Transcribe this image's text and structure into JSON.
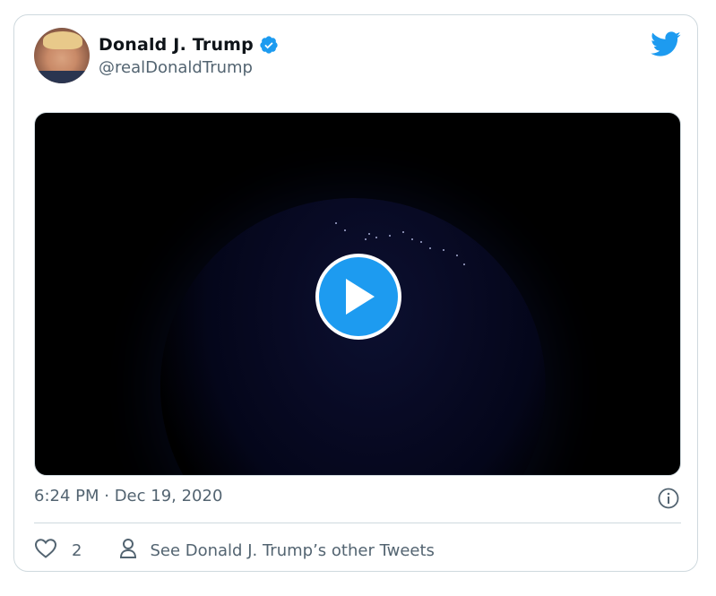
{
  "tweet": {
    "author_name": "Donald J. Trump",
    "handle": "@realDonaldTrump",
    "verified": true,
    "timestamp": "6:24 PM · Dec 19, 2020",
    "like_count": "2",
    "other_tweets_label": "See Donald J. Trump’s other Tweets"
  },
  "media": {
    "type": "video",
    "play_icon": "play-icon"
  },
  "icons": {
    "brand": "twitter-bird-icon",
    "verified": "verified-badge-icon",
    "info": "info-icon",
    "like": "heart-icon",
    "profile": "person-icon"
  },
  "colors": {
    "accent": "#1d9bf0",
    "text_primary": "#0f1419",
    "text_secondary": "#536471",
    "border": "#cfd9de"
  }
}
